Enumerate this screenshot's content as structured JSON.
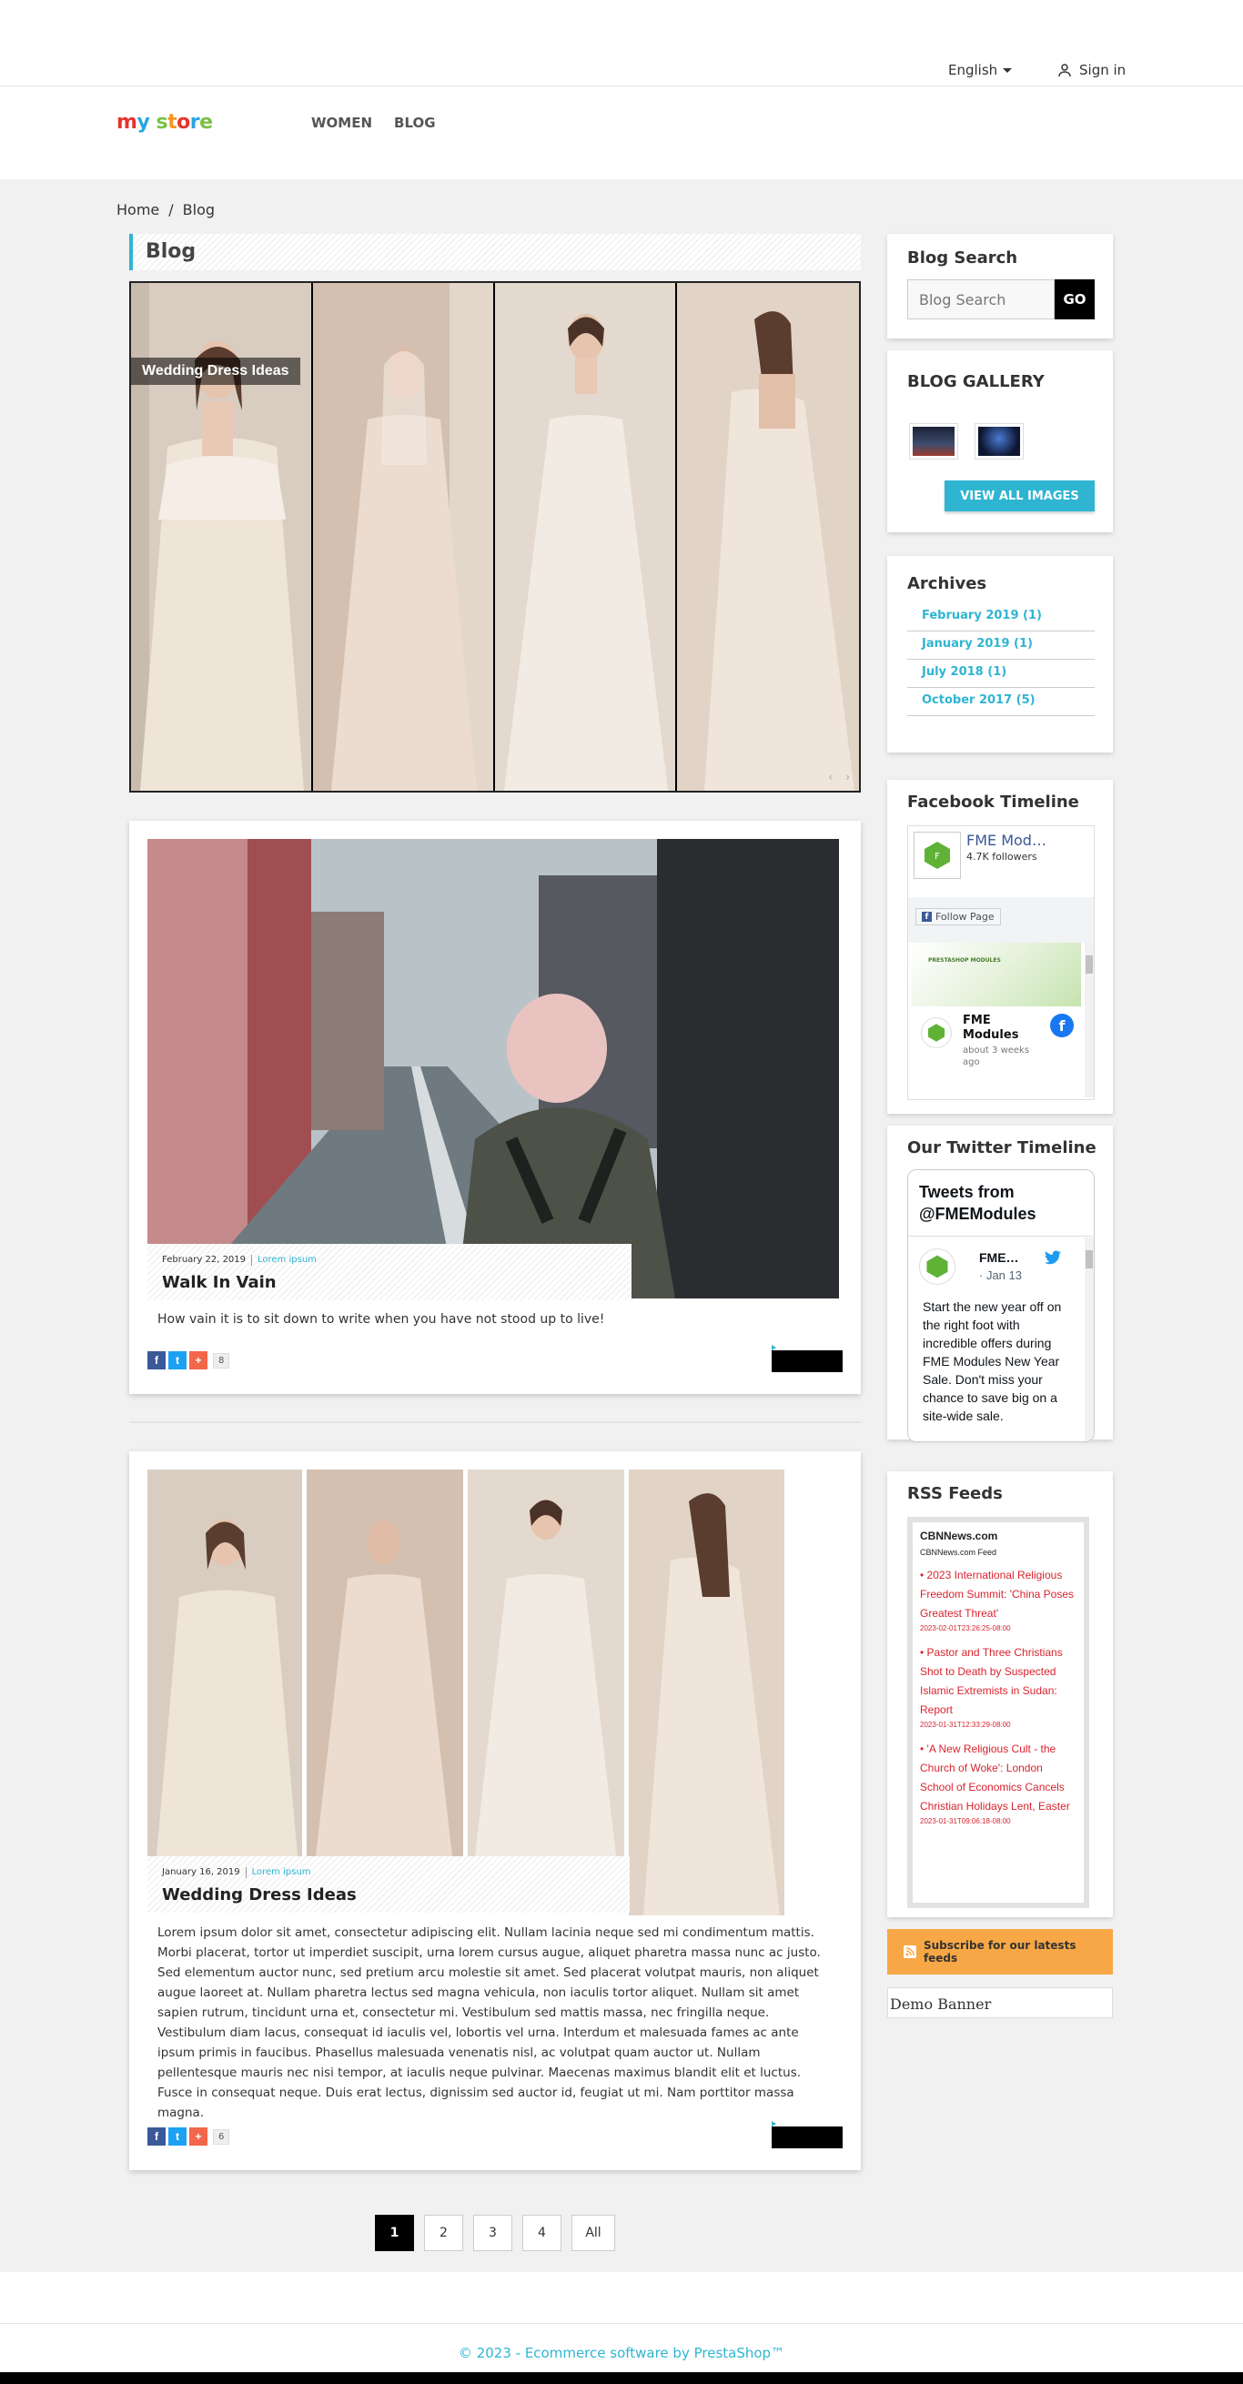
{
  "header": {
    "language": "English",
    "sign_in": "Sign in",
    "logo_text": [
      "m",
      "y",
      " ",
      "s",
      "t",
      "o",
      "r",
      "e"
    ],
    "logo_colors": [
      "#e4352c",
      "#27a6e0",
      "",
      "#7ac143",
      "#f7941d",
      "#e4352c",
      "#27a6e0",
      "#7ac143"
    ],
    "nav": [
      "WOMEN",
      "BLOG"
    ]
  },
  "breadcrumb": {
    "home": "Home",
    "separator": "/",
    "current": "Blog"
  },
  "page_title": "Blog",
  "slider": {
    "caption": "Wedding Dress Ideas",
    "prev_icon": "‹",
    "next_icon": "›"
  },
  "posts": [
    {
      "date": "February 22, 2019",
      "category": "Lorem ipsum",
      "title": "Walk In Vain",
      "excerpt": "How vain it is to sit down to write when you have not stood up to live!",
      "share_count": "8"
    },
    {
      "date": "January 16, 2019",
      "category": "Lorem ipsum",
      "title": "Wedding Dress Ideas",
      "excerpt": "Lorem ipsum dolor sit amet, consectetur adipiscing elit. Nullam lacinia neque sed mi condimentum mattis. Morbi placerat, tortor ut imperdiet suscipit, urna lorem cursus augue, aliquet pharetra massa nunc ac justo. Sed elementum auctor nunc, sed pretium arcu molestie sit amet. Sed placerat volutpat mauris, non aliquet augue laoreet at. Nullam pharetra lectus sed magna vehicula, non iaculis tortor aliquet. Nullam sit amet sapien rutrum, tincidunt urna et, consectetur mi. Vestibulum sed mattis massa, nec fringilla neque. Vestibulum diam lacus, consequat id iaculis vel, lobortis vel urna. Interdum et malesuada fames ac ante ipsum primis in faucibus. Phasellus malesuada venenatis nisl, ac volutpat quam auctor ut. Nullam pellentesque mauris nec nisi tempor, at iaculis neque pulvinar. Maecenas maximus blandit elit et luctus. Fusce in consequat neque. Duis erat lectus, dignissim sed auctor id, feugiat ut mi. Nam porttitor massa magna.",
      "share_count": "6"
    }
  ],
  "share_icons": {
    "facebook": "f",
    "twitter": "t",
    "plus": "+"
  },
  "pagination": {
    "pages": [
      "1",
      "2",
      "3",
      "4"
    ],
    "all": "All"
  },
  "sidebar": {
    "search": {
      "title": "Blog Search",
      "placeholder": "Blog Search",
      "button": "GO"
    },
    "gallery": {
      "title": "BLOG GALLERY",
      "button": "VIEW ALL IMAGES"
    },
    "archives": {
      "title": "Archives",
      "items": [
        "February 2019 (1)",
        "January 2019 (1)",
        "July 2018 (1)",
        "October 2017 (5)"
      ]
    },
    "facebook": {
      "title": "Facebook Timeline",
      "page_name": "FME Mod…",
      "followers": "4.7K followers",
      "follow_button": "Follow Page",
      "banner_text": "PRESTASHOP MODULES",
      "post_author_line1": "FME",
      "post_author_line2": "Modules",
      "post_time": "about 3 weeks ago"
    },
    "twitter": {
      "title": "Our Twitter Timeline",
      "header": "Tweets from @FMEModules",
      "author": "FME…",
      "date": "· Jan 13",
      "text": "Start the new year off on the right foot with incredible offers during FME Modules New Year Sale. Don't miss your chance to save big on a site-wide sale."
    },
    "rss": {
      "title": "RSS Feeds",
      "source": "CBNNews.com",
      "feed": "CBNNews.com Feed",
      "items": [
        {
          "title": "2023 International Religious Freedom Summit: 'China Poses Greatest Threat'",
          "date": "2023-02-01T23:26:25-08:00"
        },
        {
          "title": "Pastor and Three Christians Shot to Death by Suspected Islamic Extremists in Sudan: Report",
          "date": "2023-01-31T12:33:29-08:00"
        },
        {
          "title": "'A New Religious Cult - the Church of Woke': London School of Economics Cancels Christian Holidays Lent, Easter",
          "date": "2023-01-31T09:06:18-08:00"
        }
      ]
    },
    "subscribe": "Subscribe for our latests feeds",
    "banner_alt": "Demo Banner"
  },
  "footer": {
    "copyright": "© 2023 - Ecommerce software by PrestaShop™"
  },
  "colors": {
    "accent": "#2fb5d2",
    "rss_red": "#d9232e",
    "subscribe_bg": "#f7a745"
  }
}
